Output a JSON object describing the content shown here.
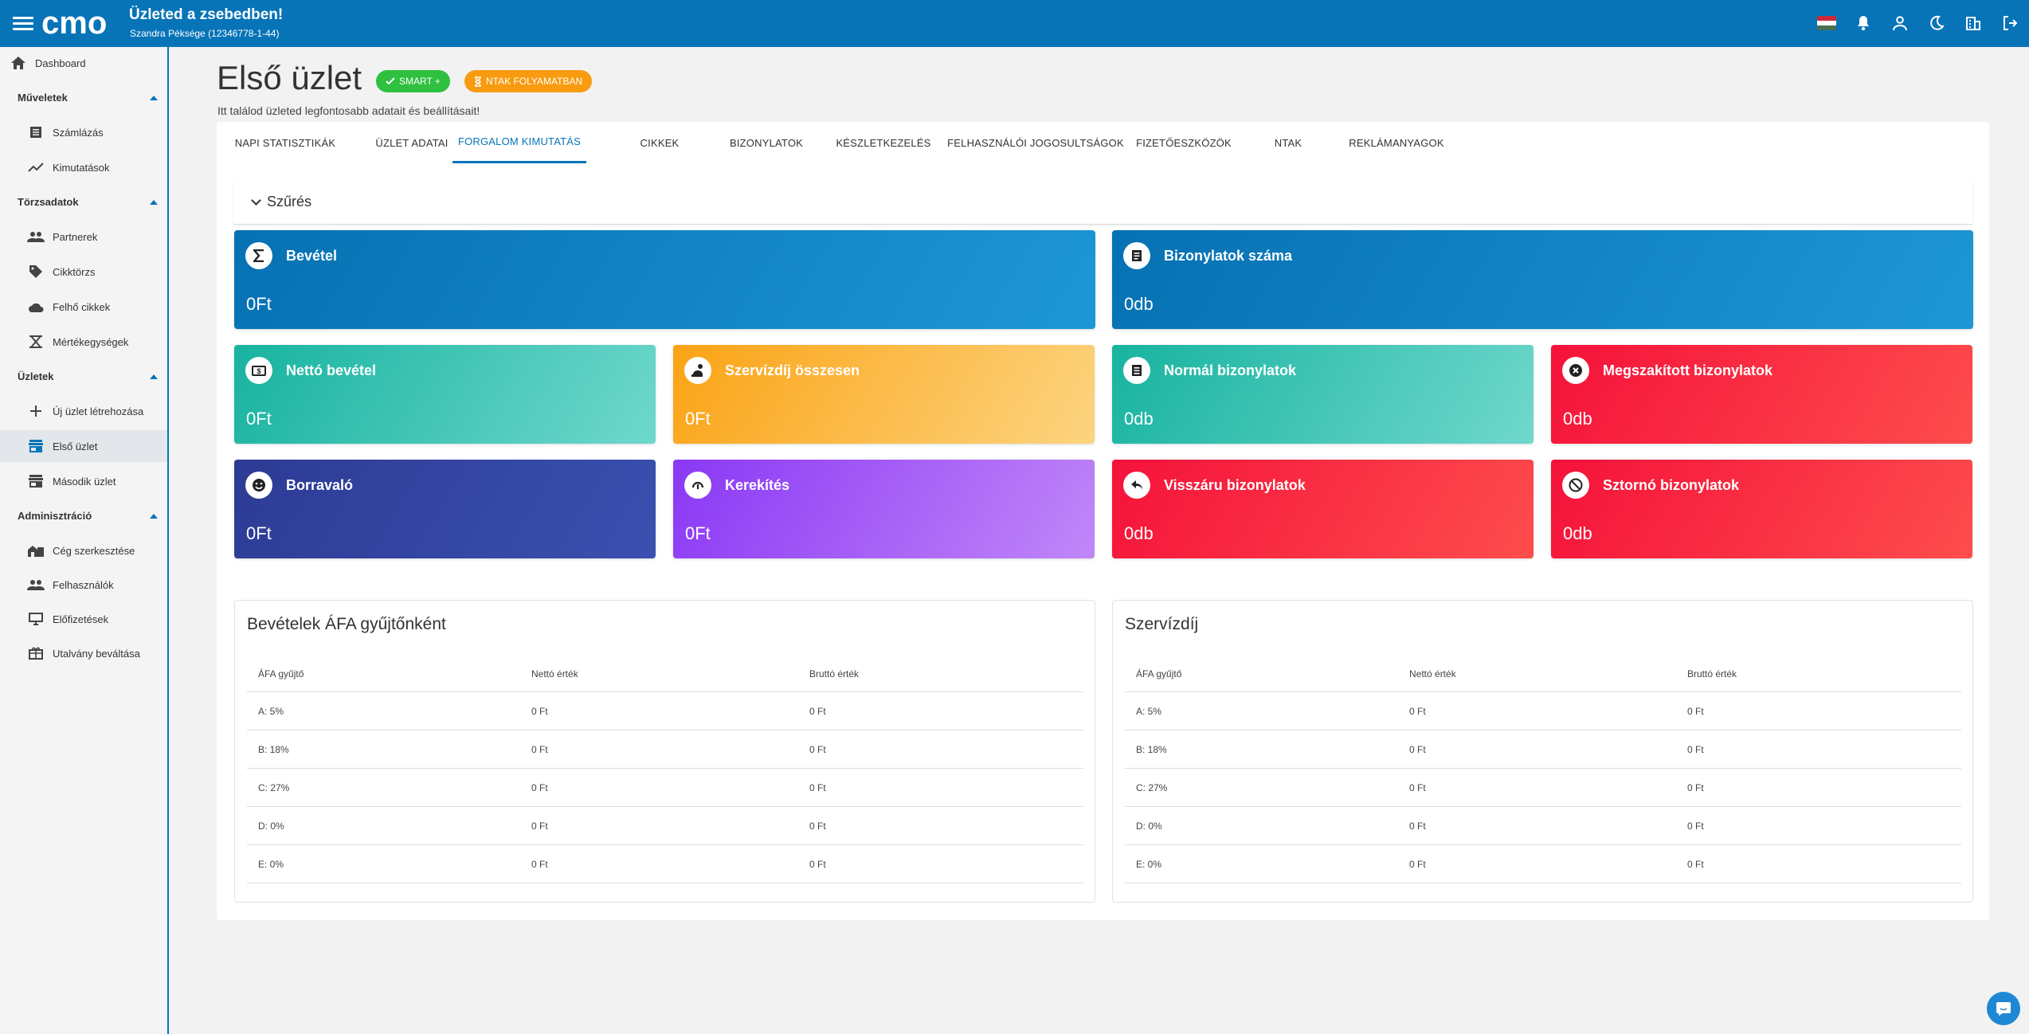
{
  "header": {
    "app_title": "Üzleted a zsebedben!",
    "company": "Szandra Péksége (12346778-1-44)",
    "logo_text": "cmo",
    "flag_colors": [
      "#ce2939",
      "#ffffff",
      "#477050"
    ],
    "icons": [
      "menu-icon",
      "flag-hu-icon",
      "bell-icon",
      "user-icon",
      "moon-icon",
      "building-icon",
      "logout-icon"
    ]
  },
  "sidebar": {
    "dashboard": "Dashboard",
    "sections": [
      {
        "title": "Műveletek",
        "items": [
          "Számlázás",
          "Kimutatások"
        ]
      },
      {
        "title": "Törzsadatok",
        "items": [
          "Partnerek",
          "Cikktörzs",
          "Felhő cikkek",
          "Mértékegységek"
        ]
      },
      {
        "title": "Üzletek",
        "items": [
          "Új üzlet létrehozása",
          "Első üzlet",
          "Második üzlet"
        ]
      },
      {
        "title": "Adminisztráció",
        "items": [
          "Cég szerkesztése",
          "Felhasználók",
          "Előfizetések",
          "Utalvány beváltása"
        ]
      }
    ],
    "active_item": "Első üzlet"
  },
  "page": {
    "title": "Első üzlet",
    "badge_smart": "SMART +",
    "badge_ntak": "NTAK FOLYAMATBAN",
    "subtitle": "Itt találod üzleted legfontosabb adatait és beállításait!"
  },
  "tabs": [
    "NAPI STATISZTIKÁK",
    "ÜZLET ADATAI",
    "FORGALOM KIMUTATÁS",
    "CIKKEK",
    "BIZONYLATOK",
    "KÉSZLETKEZELÉS",
    "FELHASZNÁLÓI JOGOSULTSÁGOK",
    "FIZETŐESZKÖZÖK",
    "NTAK",
    "REKLÁMANYAGOK"
  ],
  "active_tab": "FORGALOM KIMUTATÁS",
  "filter_label": "Szűrés",
  "cards": [
    {
      "title": "Bevétel",
      "value": "0Ft",
      "icon": "sigma-icon",
      "colors": [
        "#0671b3",
        "#1e96d6"
      ]
    },
    {
      "title": "Bizonylatok száma",
      "value": "0db",
      "icon": "receipt-icon",
      "colors": [
        "#0671b3",
        "#1e96d6"
      ]
    },
    {
      "title": "Nettó bevétel",
      "value": "0Ft",
      "icon": "money-icon",
      "colors": [
        "#18b3a0",
        "#6fd8cc"
      ]
    },
    {
      "title": "Szervízdíj összesen",
      "value": "0Ft",
      "icon": "service-icon",
      "colors": [
        "#fba315",
        "#fcd480"
      ]
    },
    {
      "title": "Normál bizonylatok",
      "value": "0db",
      "icon": "document-icon",
      "colors": [
        "#18b3a0",
        "#6fd8cc"
      ]
    },
    {
      "title": "Megszakított bizonylatok",
      "value": "0db",
      "icon": "cancel-circle-icon",
      "colors": [
        "#f5123a",
        "#fe4d4d"
      ]
    },
    {
      "title": "Borravaló",
      "value": "0Ft",
      "icon": "smiley-icon",
      "colors": [
        "#2d3b94",
        "#3a50b0"
      ]
    },
    {
      "title": "Kerekítés",
      "value": "0Ft",
      "icon": "rounding-icon",
      "colors": [
        "#8a38f5",
        "#c187f8"
      ]
    },
    {
      "title": "Visszáru bizonylatok",
      "value": "0db",
      "icon": "return-arrow-icon",
      "colors": [
        "#f5123a",
        "#fe4d4d"
      ]
    },
    {
      "title": "Sztornó bizonylatok",
      "value": "0db",
      "icon": "block-icon",
      "colors": [
        "#f5123a",
        "#fe4d4d"
      ]
    }
  ],
  "vat_table": {
    "title": "Bevételek ÁFA gyűjtőnként",
    "headers": [
      "ÁFA gyűjtő",
      "Nettó érték",
      "Bruttó érték"
    ],
    "rows": [
      [
        "A: 5%",
        "0 Ft",
        "0 Ft"
      ],
      [
        "B: 18%",
        "0 Ft",
        "0 Ft"
      ],
      [
        "C: 27%",
        "0 Ft",
        "0 Ft"
      ],
      [
        "D: 0%",
        "0 Ft",
        "0 Ft"
      ],
      [
        "E: 0%",
        "0 Ft",
        "0 Ft"
      ]
    ]
  },
  "service_table": {
    "title": "Szervízdíj",
    "headers": [
      "ÁFA gyűjtő",
      "Nettó érték",
      "Bruttó érték"
    ],
    "rows": [
      [
        "A: 5%",
        "0 Ft",
        "0 Ft"
      ],
      [
        "B: 18%",
        "0 Ft",
        "0 Ft"
      ],
      [
        "C: 27%",
        "0 Ft",
        "0 Ft"
      ],
      [
        "D: 0%",
        "0 Ft",
        "0 Ft"
      ],
      [
        "E: 0%",
        "0 Ft",
        "0 Ft"
      ]
    ]
  },
  "accent_color": "#0774b8"
}
